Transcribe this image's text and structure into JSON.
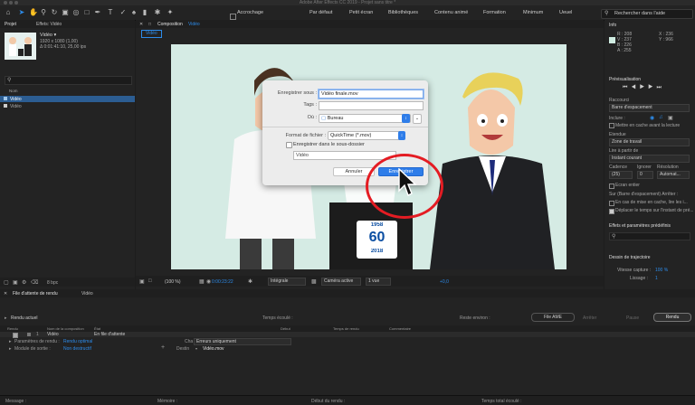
{
  "app": {
    "title": "Adobe After Effects CC 2019 - Projet sans titre *"
  },
  "toolbar": {
    "snap_label": "Accrochage",
    "workspaces": [
      "Par défaut",
      "Petit écran",
      "Bibliothèques",
      "Contenu animé",
      "Formation",
      "Minimum",
      "Ueuel"
    ],
    "search_placeholder": "Rechercher dans l'aide"
  },
  "project": {
    "tab_label": "Projet",
    "effects_tab_label": "Effets: Vidéo",
    "item_name": "Vidéo ▾",
    "item_res": "1920 x 1080 (1,00)",
    "item_dur": "Δ 0:01:41:10, 25,00 ips",
    "search_icon": "search-icon",
    "col_name": "Nom",
    "rows": [
      "Vidéo",
      "Vidéo"
    ],
    "bpc": "8 bpc"
  },
  "composition": {
    "tab_label": "Composition",
    "comp_name": "Vidéo",
    "sub_tab": "Vidéo",
    "zoom": "(100 %)",
    "timecode": "0:00:23:22",
    "quality": "Intégrale",
    "camera": "Caméra active",
    "views": "1 vue",
    "exposure": "+0,0"
  },
  "dialog": {
    "save_as_label": "Enregistrer sous :",
    "save_as_value": "Vidéo finale.mov",
    "tags_label": "Tags :",
    "where_label": "Où :",
    "where_value": "Bureau",
    "format_label": "Format de fichier :",
    "format_value": "QuickTime (*.mov)",
    "subfolder_label": "Enregistrer dans le sous-dossier",
    "subfolder_value": "Vidéo",
    "cancel_label": "Annuler",
    "save_label": "Enregistrer",
    "accent": "#2e7de9"
  },
  "badge": {
    "top": "1958",
    "bottom": "2018",
    "mid": "60"
  },
  "info": {
    "title": "Info",
    "r": "R : 208",
    "v": "V : 237",
    "b": "B : 226",
    "a": "A : 255",
    "x": "X : 236",
    "y": "Y : 966"
  },
  "preview": {
    "title": "Prévisualisation",
    "shortcut_label": "Raccourci",
    "shortcut_value": "Barre d'espacement",
    "include_label": "Inclure :",
    "cache_label": "Mettre en cache avant la lecture",
    "extent_label": "Étendue",
    "extent_value": "Zone de travail",
    "play_from_label": "Lire à partir de",
    "play_from_value": "Instant courant",
    "cadence_label": "Cadence",
    "ignore_label": "Ignorer",
    "resolution_label": "Résolution",
    "cadence_value": "(25)",
    "ignore_value": "0",
    "resolution_value": "Automat...",
    "fullscreen_label": "Écran entier",
    "stop_label": "Sur (Barre d'espacement) Arrêter :",
    "stop_opt1": "En cas de mise en cache, lire les i...",
    "stop_opt2": "Déplacer le temps sur l'instant de pré..."
  },
  "effects_panel": {
    "title": "Effets et paramètres prédéfinis"
  },
  "tracker": {
    "title": "Dessin de trajectoire",
    "capture_label": "Vitesse capture :",
    "capture_value": "100 %",
    "smooth_label": "Lissage :",
    "smooth_value": "1"
  },
  "render_queue": {
    "tab_label": "File d'attente de rendu",
    "tab2_label": "Vidéo",
    "current_render": "Rendu actuel",
    "elapsed_label": "Temps écoulé :",
    "remaining_label": "Reste environ :",
    "ame_label": "File AME",
    "stop_label": "Arrêter",
    "pause_label": "Pause",
    "render_label": "Rendu",
    "cols": [
      "Rendu",
      "Nom de la composition",
      "État",
      "Début",
      "Temps de rendu",
      "Commentaire"
    ],
    "row_num": "1",
    "row_name": "Vidéo",
    "row_status": "En file d'attente",
    "settings_label": "Paramètres de rendu :",
    "settings_value": "Rendu optimal",
    "output_label": "Module de sortie :",
    "output_value": "Non destructif",
    "log_label": "Cha",
    "log_value": "Erreurs uniquement",
    "dest_label": "Destin",
    "dest_value": "Vidéo.mov",
    "footer_message": "Message :",
    "footer_memory": "Mémoire :",
    "footer_start": "Début du rendu :",
    "footer_total": "Temps total écoulé :"
  }
}
